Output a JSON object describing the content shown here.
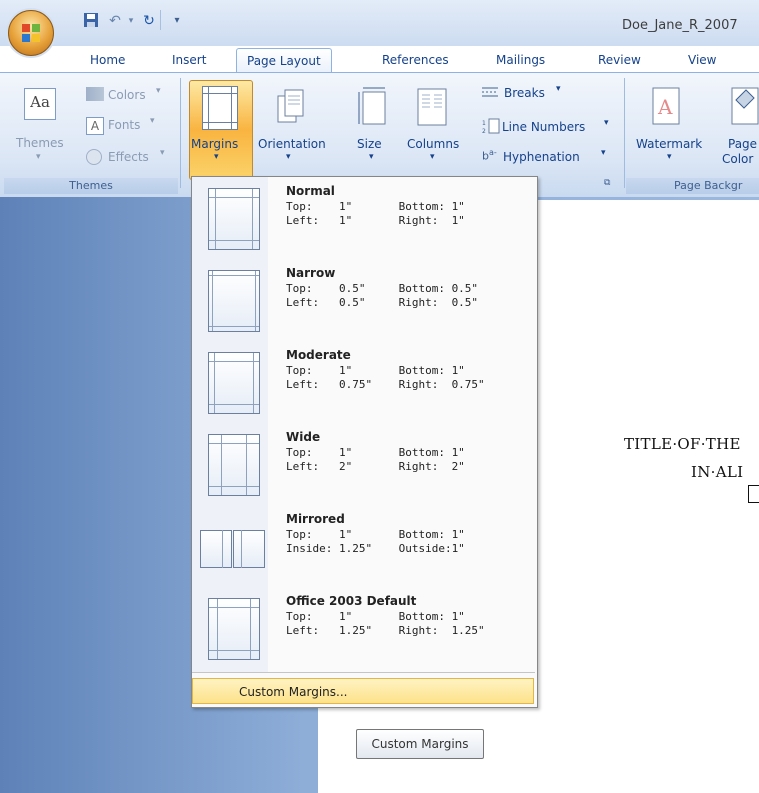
{
  "window": {
    "title": "Doe_Jane_R_2007",
    "qat": {
      "save_icon": "save-icon",
      "undo_icon": "undo-icon",
      "redo_icon": "redo-icon",
      "customize_icon": "customize-qat-icon"
    }
  },
  "tabs": [
    "Home",
    "Insert",
    "Page Layout",
    "References",
    "Mailings",
    "Review",
    "View"
  ],
  "ribbon": {
    "themes_group": {
      "themes_label": "Themes",
      "colors_label": "Colors",
      "fonts_label": "Fonts",
      "effects_label": "Effects",
      "group_label": "Themes"
    },
    "page_setup_group": {
      "margins_label": "Margins",
      "orientation_label": "Orientation",
      "size_label": "Size",
      "columns_label": "Columns",
      "breaks_label": "Breaks",
      "line_numbers_label": "Line Numbers",
      "hyphenation_label": "Hyphenation"
    },
    "page_background_group": {
      "watermark_label": "Watermark",
      "page_color_label_1": "Page",
      "page_color_label_2": "Color",
      "group_label": "Page Backgr"
    }
  },
  "margins_menu": {
    "items": [
      {
        "name": "Normal",
        "row1": "Top:    1\"       Bottom: 1\"",
        "row2": "Left:   1\"       Right:  1\""
      },
      {
        "name": "Narrow",
        "row1": "Top:    0.5\"     Bottom: 0.5\"",
        "row2": "Left:   0.5\"     Right:  0.5\""
      },
      {
        "name": "Moderate",
        "row1": "Top:    1\"       Bottom: 1\"",
        "row2": "Left:   0.75\"    Right:  0.75\""
      },
      {
        "name": "Wide",
        "row1": "Top:    1\"       Bottom: 1\"",
        "row2": "Left:   2\"       Right:  2\""
      },
      {
        "name": "Mirrored",
        "row1": "Top:    1\"       Bottom: 1\"",
        "row2": "Inside: 1.25\"    Outside:1\""
      },
      {
        "name": "Office 2003 Default",
        "row1": "Top:    1\"       Bottom: 1\"",
        "row2": "Left:   1.25\"    Right:  1.25\""
      }
    ],
    "custom_label": "Custom Margins..."
  },
  "tooltip": "Custom Margins",
  "document": {
    "title_line1": "TITLE·OF·THE",
    "title_line2": "IN·ALI"
  }
}
